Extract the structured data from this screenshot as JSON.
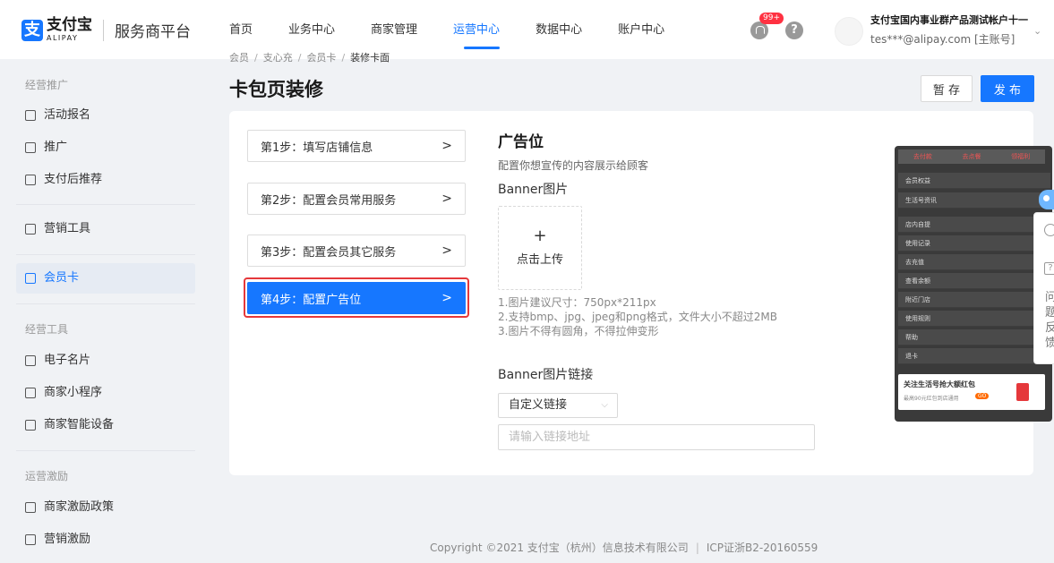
{
  "header": {
    "logo_cn": "支付宝",
    "logo_en": "ALIPAY",
    "platform": "服务商平台",
    "nav": [
      {
        "label": "首页",
        "active": false
      },
      {
        "label": "业务中心",
        "active": false
      },
      {
        "label": "商家管理",
        "active": false
      },
      {
        "label": "运营中心",
        "active": true
      },
      {
        "label": "数据中心",
        "active": false
      },
      {
        "label": "账户中心",
        "active": false
      }
    ],
    "notification_badge": "99+",
    "help_glyph": "?",
    "account_name": "支付宝国内事业群产品测试帐户十一",
    "account_email": "tes***@alipay.com [主账号]"
  },
  "sidebar": {
    "group_promo": "经营推广",
    "item_activity": "活动报名",
    "item_promote": "推广",
    "item_after_pay": "支付后推荐",
    "item_marketing": "营销工具",
    "item_member_card": "会员卡",
    "group_tools": "经营工具",
    "item_ecard": "电子名片",
    "item_miniapp": "商家小程序",
    "item_device": "商家智能设备",
    "group_incentive": "运营激励",
    "item_policy": "商家激励政策",
    "item_sales_incentive": "营销激励"
  },
  "breadcrumb": [
    "会员",
    "支心充",
    "会员卡",
    "装修卡面"
  ],
  "page_title": "卡包页装修",
  "actions": {
    "save": "暂 存",
    "publish": "发 布"
  },
  "steps": [
    {
      "label": "第1步：填写店铺信息",
      "active": false
    },
    {
      "label": "第2步：配置会员常用服务",
      "active": false
    },
    {
      "label": "第3步：配置会员其它服务",
      "active": false
    },
    {
      "label": "第4步：配置广告位",
      "active": true
    }
  ],
  "step_arrow": ">",
  "ad": {
    "title": "广告位",
    "subtitle": "配置你想宣传的内容展示给顾客",
    "banner_label": "Banner图片",
    "upload_plus": "+",
    "upload_text": "点击上传",
    "hint1": "1.图片建议尺寸：750px*211px",
    "hint2": "2.支持bmp、jpg、jpeg和png格式，文件大小不超过2MB",
    "hint3": "3.图片不得有圆角，不得拉伸变形",
    "link_label": "Banner图片链接",
    "link_type": "自定义链接",
    "link_placeholder": "请输入链接地址"
  },
  "preview": {
    "tab1": "去付款",
    "tab2": "去点餐",
    "tab3": "领福利",
    "rows": [
      "会员权益",
      "生活号资讯",
      "店内自提",
      "使用记录",
      "去充值",
      "查看余额",
      "附近门店",
      "使用规则",
      "帮助",
      "退卡"
    ],
    "banner_title": "关注生活号抢大额红包",
    "banner_sub": "最高90元红包到店通用",
    "banner_go": "GO"
  },
  "float": {
    "feedback": "问题反馈"
  },
  "footer": {
    "copyright": "Copyright ©2021 支付宝（杭州）信息技术有限公司",
    "icp": "ICP证浙B2-20160559"
  }
}
